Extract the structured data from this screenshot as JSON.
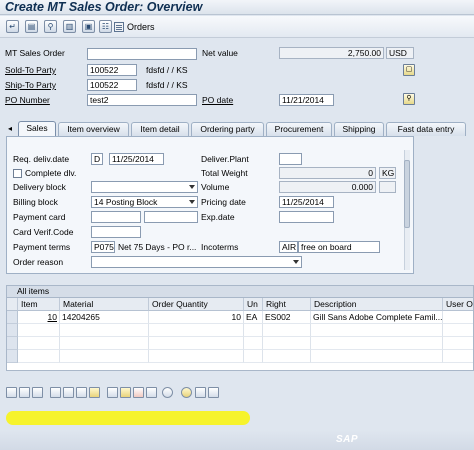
{
  "window": {
    "title": "Create MT Sales Order: Overview"
  },
  "toolbar": {
    "icons": [
      "enter-icon",
      "display-header-icon",
      "display-item-icon",
      "header-partner-icon",
      "item-icon",
      "partner-icon"
    ],
    "orders_label": "Orders"
  },
  "header": {
    "mt_sales_order_label": "MT Sales Order",
    "mt_sales_order_value": "",
    "net_value_label": "Net value",
    "net_value": "2,750.00",
    "currency": "USD",
    "sold_to_label": "Sold-To Party",
    "sold_to_value": "100522",
    "sold_to_name": "fdsfd / / KS",
    "ship_to_label": "Ship-To Party",
    "ship_to_value": "100522",
    "ship_to_name": "fdsfd / / KS",
    "po_number_label": "PO Number",
    "po_number_value": "test2",
    "po_date_label": "PO date",
    "po_date_value": "11/21/2014"
  },
  "tabs": [
    {
      "label": "Sales",
      "active": true
    },
    {
      "label": "Item overview",
      "active": false
    },
    {
      "label": "Item detail",
      "active": false
    },
    {
      "label": "Ordering party",
      "active": false
    },
    {
      "label": "Procurement",
      "active": false
    },
    {
      "label": "Shipping",
      "active": false
    },
    {
      "label": "Fast data entry",
      "active": false
    }
  ],
  "sales": {
    "req_deliv_date_label": "Req. deliv.date",
    "req_deliv_date_format": "D",
    "req_deliv_date_value": "11/25/2014",
    "deliver_plant_label": "Deliver.Plant",
    "deliver_plant_value": "",
    "complete_dlv_label": "Complete dlv.",
    "total_weight_label": "Total Weight",
    "total_weight_value": "0",
    "total_weight_unit": "KG",
    "delivery_block_label": "Delivery block",
    "delivery_block_value": "",
    "volume_label": "Volume",
    "volume_value": "0.000",
    "billing_block_label": "Billing block",
    "billing_block_value": "14 Posting Block",
    "pricing_date_label": "Pricing date",
    "pricing_date_value": "11/25/2014",
    "payment_card_label": "Payment card",
    "exp_date_label": "Exp.date",
    "card_verif_label": "Card Verif.Code",
    "payment_terms_label": "Payment terms",
    "payment_terms_code": "P075",
    "payment_terms_text": "Net 75 Days - PO r...",
    "incoterms_label": "Incoterms",
    "incoterms_code": "AIR",
    "incoterms_text": "free on board",
    "order_reason_label": "Order reason",
    "order_reason_value": ""
  },
  "items": {
    "section_label": "All items",
    "columns": [
      "Item",
      "Material",
      "Order Quantity",
      "Un",
      "Right",
      "Description",
      "User Ou"
    ],
    "rows": [
      {
        "item": "10",
        "material": "14204265",
        "quantity": "10",
        "unit": "EA",
        "right": "ES002",
        "description": "Gill Sans Adobe Complete Famil..."
      }
    ]
  },
  "bottom_toolbar": {
    "icons": [
      "details-icon",
      "insert-row-icon",
      "delete-row-icon",
      "select-all-icon",
      "deselect-all-icon",
      "configuration-icon",
      "schedule-lines-icon",
      "sort-icon",
      "pricing-icon",
      "stock-icon",
      "copy-icon",
      "search-icon",
      "find-next-icon",
      "change-icon"
    ]
  },
  "branding": {
    "logo": "SAP"
  },
  "colors": {
    "highlight": "#f7f41b",
    "title": "#0f2f52"
  }
}
